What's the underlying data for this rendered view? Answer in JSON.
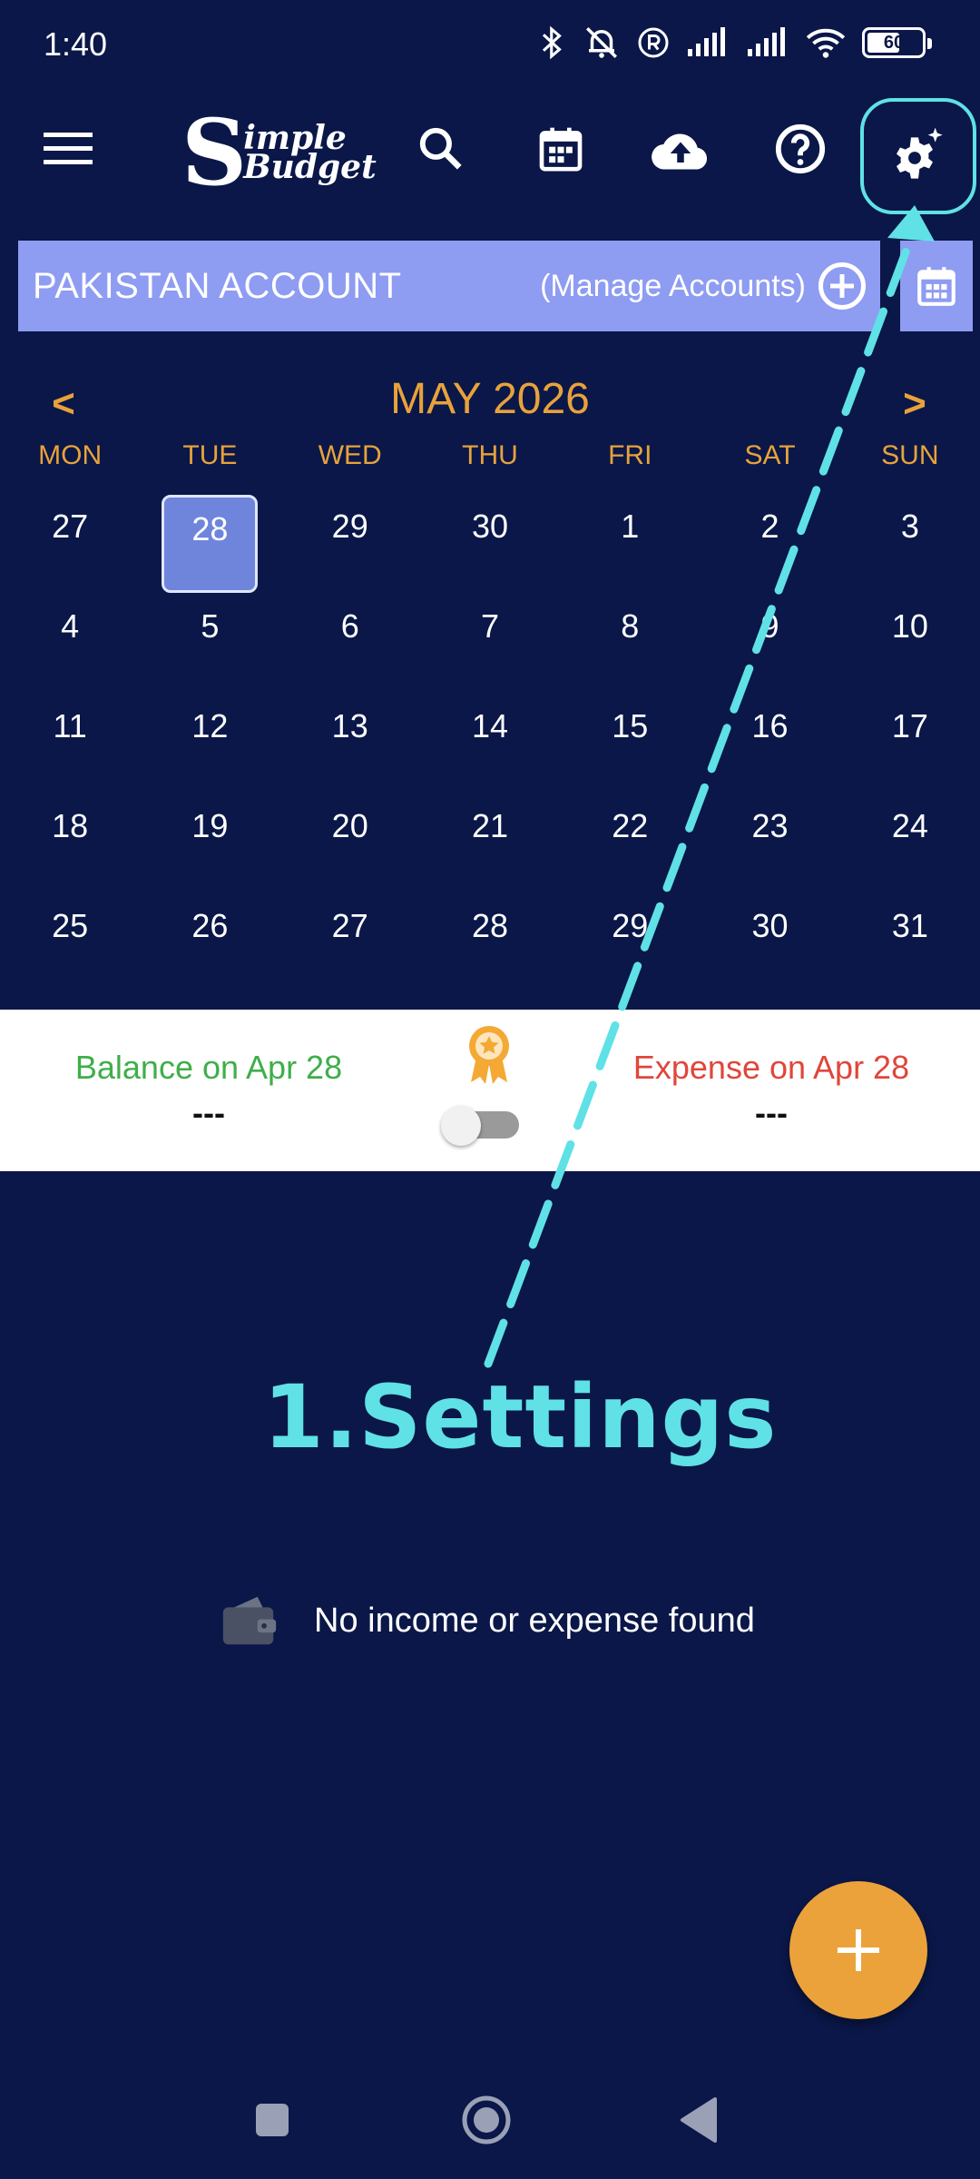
{
  "status_bar": {
    "time": "1:40",
    "battery": "60",
    "battery_level": 0.6
  },
  "toolbar": {
    "logo_big_letter": "S",
    "logo_line1": "imple",
    "logo_line2": "Budget",
    "icons": [
      "menu-icon",
      "search-icon",
      "calendar-icon",
      "cloud-upload-icon",
      "help-icon",
      "settings-icon"
    ]
  },
  "account": {
    "name": "PAKISTAN ACCOUNT",
    "manage_label": "(Manage Accounts)"
  },
  "calendar": {
    "prev": "<",
    "next": ">",
    "month_title": "MAY 2026",
    "weekdays": [
      "MON",
      "TUE",
      "WED",
      "THU",
      "FRI",
      "SAT",
      "SUN"
    ],
    "days": [
      "27",
      "28",
      "29",
      "30",
      "1",
      "2",
      "3",
      "4",
      "5",
      "6",
      "7",
      "8",
      "9",
      "10",
      "11",
      "12",
      "13",
      "14",
      "15",
      "16",
      "17",
      "18",
      "19",
      "20",
      "21",
      "22",
      "23",
      "24",
      "25",
      "26",
      "27",
      "28",
      "29",
      "30",
      "31"
    ],
    "selected_index": 1
  },
  "summary": {
    "balance_label": "Balance on Apr 28",
    "balance_value": "---",
    "expense_label": "Expense on Apr 28",
    "expense_value": "---",
    "toggle_on": false
  },
  "annotation": {
    "label": "1.Settings",
    "color": "#5fe1e6"
  },
  "empty_state": {
    "text": "No income or expense found"
  },
  "colors": {
    "background": "#0a1748",
    "account_bar": "#8e9cf2",
    "accent": "#e8a23b",
    "balance": "#3fae4a",
    "expense": "#e0463a",
    "fab": "#eca23a"
  }
}
